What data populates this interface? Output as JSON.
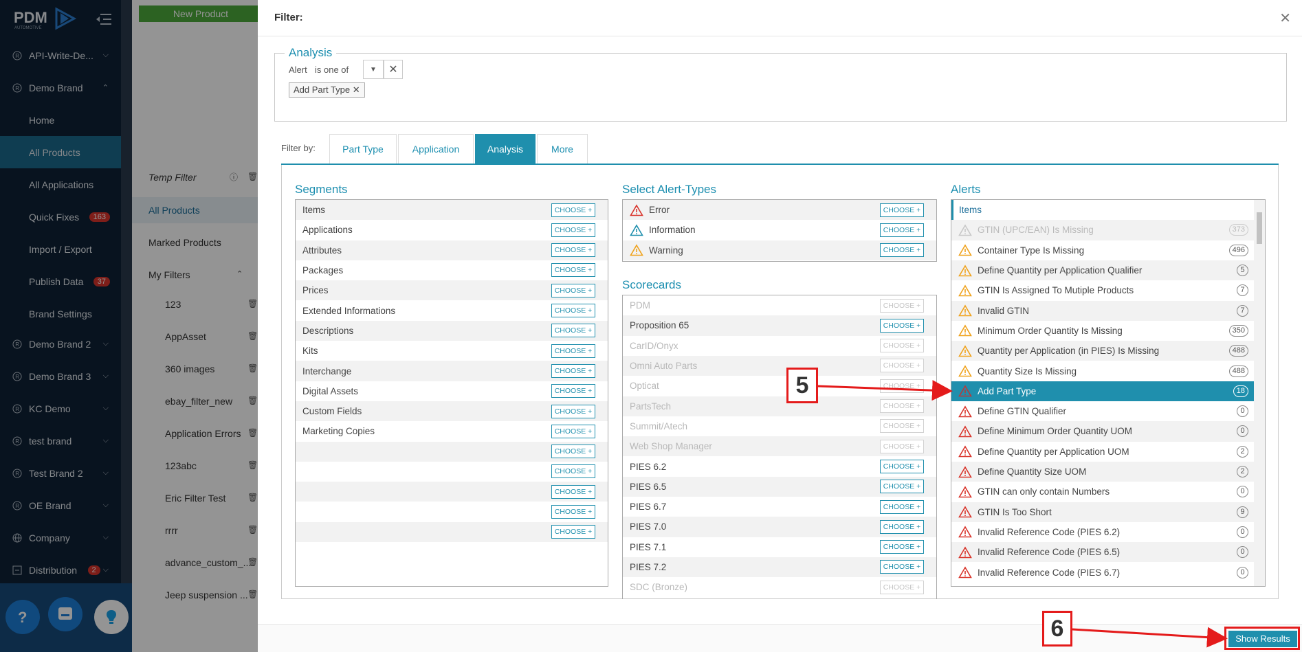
{
  "sidebar": {
    "logo_text": "PDM",
    "logo_sub": "AUTOMOTIVE",
    "items": [
      {
        "label": "API-Write-De...",
        "icon": "brand-r-icon"
      },
      {
        "label": "Demo Brand",
        "icon": "brand-r-icon"
      },
      {
        "label": "Home"
      },
      {
        "label": "All Products"
      },
      {
        "label": "All Applications"
      },
      {
        "label": "Quick Fixes",
        "badge": "163"
      },
      {
        "label": "Import / Export"
      },
      {
        "label": "Publish Data",
        "badge": "37"
      },
      {
        "label": "Brand Settings"
      },
      {
        "label": "Demo Brand 2",
        "icon": "brand-r-icon"
      },
      {
        "label": "Demo Brand 3",
        "icon": "brand-r-icon"
      },
      {
        "label": "KC Demo",
        "icon": "brand-r-icon"
      },
      {
        "label": "test brand",
        "icon": "brand-r-icon"
      },
      {
        "label": "Test Brand 2",
        "icon": "brand-r-icon"
      },
      {
        "label": "OE Brand",
        "icon": "brand-r-icon"
      },
      {
        "label": "Company",
        "icon": "globe-icon"
      },
      {
        "label": "Distribution",
        "icon": "distribution-icon",
        "badge": "2"
      }
    ]
  },
  "background": {
    "new_product": "New Product",
    "temp_filter": "Temp Filter",
    "all_products": "All Products",
    "marked_products": "Marked Products",
    "my_filters": "My Filters",
    "filters": [
      "123",
      "AppAsset",
      "360 images",
      "ebay_filter_new",
      "Application Errors",
      "123abc",
      "Eric Filter Test",
      "rrrr",
      "advance_custom_...",
      "Jeep suspension ..."
    ]
  },
  "modal": {
    "title": "Filter:",
    "analysis": {
      "legend": "Analysis",
      "alert_label": "Alert",
      "operator": "is one of",
      "chip": "Add Part Type"
    },
    "filter_by": "Filter by:",
    "tabs": [
      "Part Type",
      "Application",
      "Analysis",
      "More"
    ],
    "choose_label": "CHOOSE +",
    "segments": {
      "title": "Segments",
      "rows": [
        "Items",
        "Applications",
        "Attributes",
        "Packages",
        "Prices",
        "Extended Informations",
        "Descriptions",
        "Kits",
        "Interchange",
        "Digital Assets",
        "Custom Fields",
        "Marketing Copies",
        "",
        "",
        "",
        "",
        ""
      ]
    },
    "alert_types": {
      "title": "Select Alert-Types",
      "rows": [
        {
          "label": "Error",
          "icon": "error-triangle-icon"
        },
        {
          "label": "Information",
          "icon": "info-triangle-icon"
        },
        {
          "label": "Warning",
          "icon": "warning-triangle-icon"
        }
      ]
    },
    "scorecards": {
      "title": "Scorecards",
      "rows": [
        {
          "label": "PDM",
          "disabled": true
        },
        {
          "label": "Proposition 65",
          "disabled": false
        },
        {
          "label": "CarID/Onyx",
          "disabled": true
        },
        {
          "label": "Omni Auto Parts",
          "disabled": true
        },
        {
          "label": "Opticat",
          "disabled": true
        },
        {
          "label": "PartsTech",
          "disabled": true
        },
        {
          "label": "Summit/Atech",
          "disabled": true
        },
        {
          "label": "Web Shop Manager",
          "disabled": true
        },
        {
          "label": "PIES 6.2",
          "disabled": false
        },
        {
          "label": "PIES 6.5",
          "disabled": false
        },
        {
          "label": "PIES 6.7",
          "disabled": false
        },
        {
          "label": "PIES 7.0",
          "disabled": false
        },
        {
          "label": "PIES 7.1",
          "disabled": false
        },
        {
          "label": "PIES 7.2",
          "disabled": false
        },
        {
          "label": "SDC (Bronze)",
          "disabled": true
        }
      ]
    },
    "alerts": {
      "title": "Alerts",
      "header": "Items",
      "rows": [
        {
          "label": "GTIN (UPC/EAN) Is Missing",
          "count": "373",
          "level": "disabled"
        },
        {
          "label": "Container Type Is Missing",
          "count": "496",
          "level": "warning"
        },
        {
          "label": "Define Quantity per Application Qualifier",
          "count": "5",
          "level": "warning"
        },
        {
          "label": "GTIN Is Assigned To Mutiple Products",
          "count": "7",
          "level": "warning"
        },
        {
          "label": "Invalid GTIN",
          "count": "7",
          "level": "warning"
        },
        {
          "label": "Minimum Order Quantity Is Missing",
          "count": "350",
          "level": "warning"
        },
        {
          "label": "Quantity per Application (in PIES) Is Missing",
          "count": "488",
          "level": "warning"
        },
        {
          "label": "Quantity Size Is Missing",
          "count": "488",
          "level": "warning"
        },
        {
          "label": "Add Part Type",
          "count": "18",
          "level": "selected"
        },
        {
          "label": "Define GTIN Qualifier",
          "count": "0",
          "level": "error"
        },
        {
          "label": "Define Minimum Order Quantity UOM",
          "count": "0",
          "level": "error"
        },
        {
          "label": "Define Quantity per Application UOM",
          "count": "2",
          "level": "error"
        },
        {
          "label": "Define Quantity Size UOM",
          "count": "2",
          "level": "error"
        },
        {
          "label": "GTIN can only contain Numbers",
          "count": "0",
          "level": "error"
        },
        {
          "label": "GTIN Is Too Short",
          "count": "9",
          "level": "error"
        },
        {
          "label": "Invalid Reference Code (PIES 6.2)",
          "count": "0",
          "level": "error"
        },
        {
          "label": "Invalid Reference Code (PIES 6.5)",
          "count": "0",
          "level": "error"
        },
        {
          "label": "Invalid Reference Code (PIES 6.7)",
          "count": "0",
          "level": "error"
        }
      ]
    },
    "show_results": "Show Results"
  },
  "annotations": {
    "step5": "5",
    "step6": "6"
  },
  "colors": {
    "accent": "#1f8fad",
    "sidebar": "#0f2136",
    "annotation": "#e41b1b",
    "warning": "#f0a21b",
    "error": "#d9342b"
  }
}
